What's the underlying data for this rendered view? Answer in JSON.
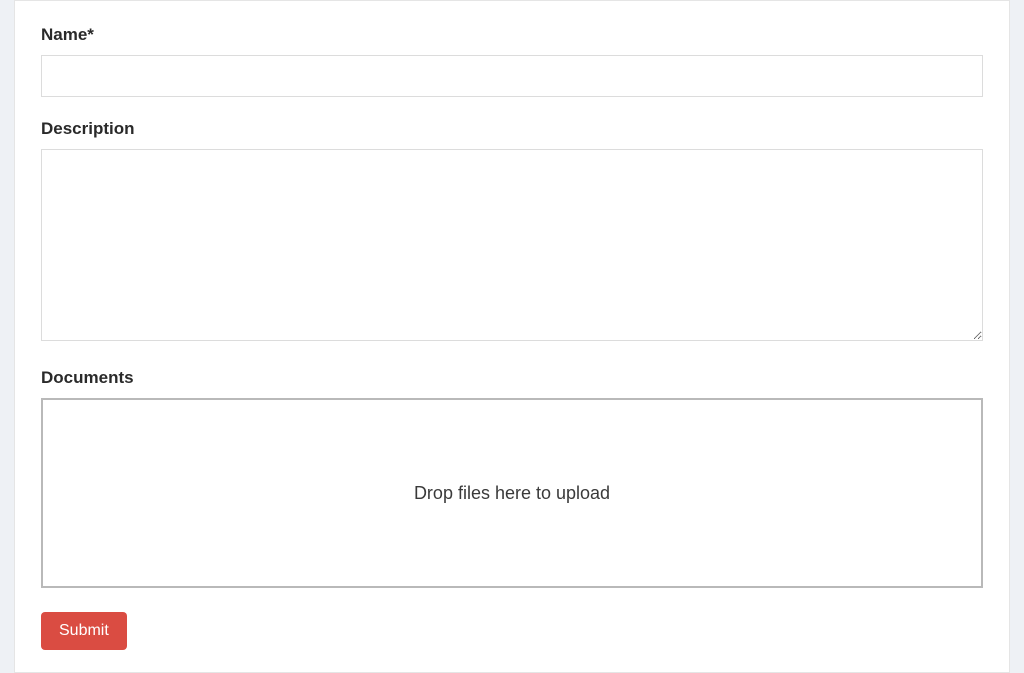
{
  "form": {
    "name": {
      "label": "Name*",
      "value": ""
    },
    "description": {
      "label": "Description",
      "value": ""
    },
    "documents": {
      "label": "Documents",
      "dropzone_text": "Drop files here to upload"
    },
    "submit_label": "Submit"
  }
}
